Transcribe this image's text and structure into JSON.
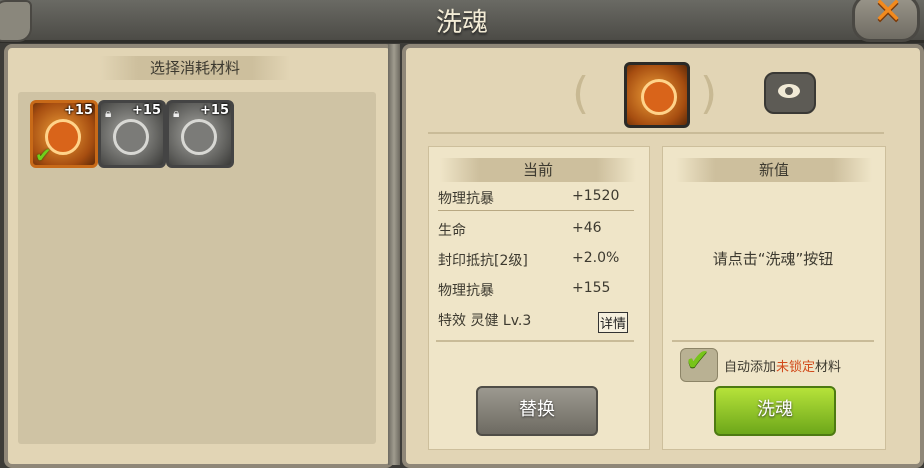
{
  "window": {
    "title": "洗魂"
  },
  "left_panel": {
    "header": "选择消耗材料",
    "materials": [
      {
        "plus": "+15",
        "state": "selected",
        "locked": false
      },
      {
        "plus": "+15",
        "state": "locked",
        "locked": true
      },
      {
        "plus": "+15",
        "state": "locked",
        "locked": true
      }
    ]
  },
  "current": {
    "header": "当前",
    "stats": [
      {
        "name": "物理抗暴",
        "value": "+1520"
      },
      {
        "name": "生命",
        "value": "+46"
      },
      {
        "name": "封印抵抗[2级]",
        "value": "+2.0%"
      },
      {
        "name": "物理抗暴",
        "value": "+155"
      },
      {
        "name": "特效 灵健 Lv.3",
        "value": ""
      }
    ],
    "detail_label": "详情"
  },
  "new_value": {
    "header": "新值",
    "hint": "请点击“洗魂”按钮",
    "auto_add_prefix": "自动添加",
    "auto_add_highlight": "未锁定",
    "auto_add_suffix": "材料",
    "auto_add_checked": true
  },
  "buttons": {
    "replace": "替换",
    "wash": "洗魂"
  },
  "colors": {
    "accent_orange": "#d9641a",
    "confirm_green": "#7ab81e",
    "highlight_red": "#d24a1b"
  }
}
